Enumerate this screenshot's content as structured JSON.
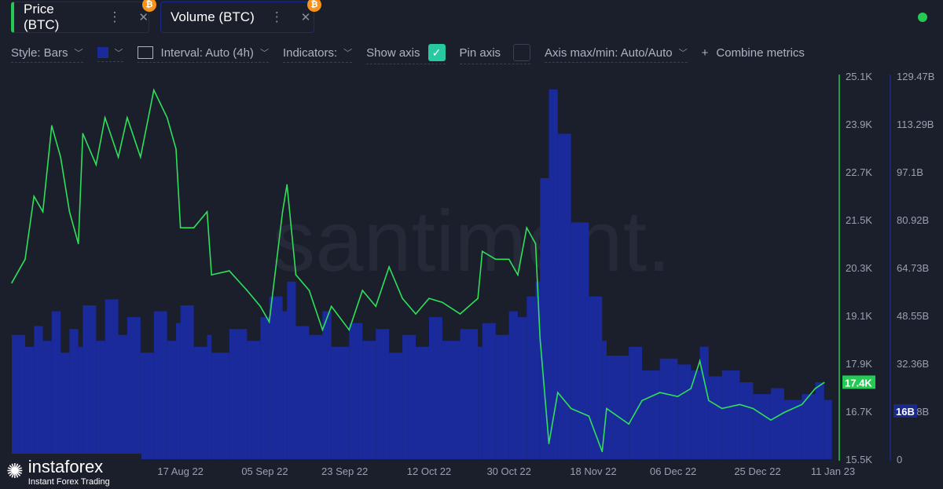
{
  "tabs": [
    {
      "label": "Price (BTC)",
      "color": "#26c953"
    },
    {
      "label": "Volume (BTC)",
      "color": "#1a2a8a"
    }
  ],
  "toolbar": {
    "style": "Style: Bars",
    "interval": "Interval: Auto (4h)",
    "indicators": "Indicators:",
    "show_axis": "Show axis",
    "show_axis_checked": true,
    "pin_axis": "Pin axis",
    "pin_axis_checked": false,
    "axis_maxmin": "Axis max/min: Auto/Auto",
    "combine": "Combine metrics",
    "combine_icon": "+"
  },
  "colors": {
    "price": "#2ee05a",
    "volume": "#1a2a9a",
    "accent": "#26c953"
  },
  "watermark": "santiment.",
  "logo": {
    "name": "instaforex",
    "tagline": "Instant Forex Trading"
  },
  "chart_data": {
    "type": "line+bar",
    "x_ticks": [
      "17 Aug 22",
      "05 Sep 22",
      "23 Sep 22",
      "12 Oct 22",
      "30 Oct 22",
      "18 Nov 22",
      "06 Dec 22",
      "25 Dec 22",
      "11 Jan 23"
    ],
    "x_tick_dates": [
      "2022-08-17",
      "2022-09-05",
      "2022-09-23",
      "2022-10-12",
      "2022-10-30",
      "2022-11-18",
      "2022-12-06",
      "2022-12-25",
      "2023-01-11"
    ],
    "xlim": [
      "2022-07-10",
      "2023-01-11"
    ],
    "price_axis": {
      "ticks": [
        "25.1K",
        "23.9K",
        "22.7K",
        "21.5K",
        "20.3K",
        "19.1K",
        "17.9K",
        "16.7K",
        "15.5K"
      ],
      "ylim": [
        15.5,
        25.1
      ],
      "unit": "K",
      "last": "17.4K"
    },
    "volume_axis": {
      "ticks": [
        "129.47B",
        "113.29B",
        "97.1B",
        "80.92B",
        "64.73B",
        "48.55B",
        "32.36B",
        "16.18B",
        "0"
      ],
      "ylim": [
        0,
        129.47
      ],
      "last": "16B"
    },
    "dates": [
      "2022-07-10",
      "2022-07-13",
      "2022-07-15",
      "2022-07-17",
      "2022-07-19",
      "2022-07-21",
      "2022-07-23",
      "2022-07-25",
      "2022-07-26",
      "2022-07-29",
      "2022-07-31",
      "2022-08-03",
      "2022-08-05",
      "2022-08-08",
      "2022-08-11",
      "2022-08-14",
      "2022-08-16",
      "2022-08-17",
      "2022-08-20",
      "2022-08-23",
      "2022-08-24",
      "2022-08-28",
      "2022-09-01",
      "2022-09-04",
      "2022-09-06",
      "2022-09-09",
      "2022-09-10",
      "2022-09-12",
      "2022-09-15",
      "2022-09-18",
      "2022-09-20",
      "2022-09-24",
      "2022-09-27",
      "2022-09-30",
      "2022-10-03",
      "2022-10-06",
      "2022-10-09",
      "2022-10-12",
      "2022-10-15",
      "2022-10-19",
      "2022-10-23",
      "2022-10-24",
      "2022-10-27",
      "2022-10-30",
      "2022-11-01",
      "2022-11-03",
      "2022-11-05",
      "2022-11-06",
      "2022-11-08",
      "2022-11-10",
      "2022-11-13",
      "2022-11-17",
      "2022-11-20",
      "2022-11-21",
      "2022-11-26",
      "2022-11-29",
      "2022-12-03",
      "2022-12-07",
      "2022-12-10",
      "2022-12-12",
      "2022-12-14",
      "2022-12-17",
      "2022-12-21",
      "2022-12-24",
      "2022-12-28",
      "2022-12-31",
      "2023-01-04",
      "2023-01-07",
      "2023-01-09"
    ],
    "series": [
      {
        "name": "Price (BTC)",
        "type": "line",
        "values": [
          19.92,
          20.51,
          22.09,
          21.7,
          23.86,
          23.07,
          21.7,
          20.9,
          23.66,
          22.88,
          24.06,
          23.07,
          24.06,
          23.07,
          24.75,
          24.06,
          23.27,
          21.3,
          21.3,
          21.7,
          20.12,
          20.22,
          19.73,
          19.33,
          18.94,
          21.7,
          22.38,
          20.12,
          19.73,
          18.74,
          19.33,
          18.74,
          19.73,
          19.33,
          20.32,
          19.53,
          19.14,
          19.53,
          19.43,
          19.14,
          19.53,
          20.71,
          20.51,
          20.51,
          20.12,
          21.3,
          20.9,
          18.54,
          15.89,
          17.17,
          16.77,
          16.58,
          15.69,
          16.77,
          16.38,
          16.97,
          17.17,
          17.07,
          17.27,
          17.96,
          16.97,
          16.77,
          16.87,
          16.77,
          16.48,
          16.67,
          16.87,
          17.27,
          17.42
        ]
      },
      {
        "name": "Volume (BTC)",
        "type": "bar",
        "values": [
          42,
          38,
          45,
          40,
          50,
          36,
          44,
          38,
          52,
          40,
          54,
          42,
          48,
          36,
          50,
          40,
          46,
          52,
          38,
          42,
          36,
          44,
          40,
          48,
          55,
          50,
          60,
          45,
          42,
          50,
          38,
          46,
          40,
          44,
          36,
          42,
          38,
          48,
          40,
          44,
          38,
          46,
          42,
          50,
          48,
          55,
          60,
          95,
          125,
          110,
          80,
          55,
          40,
          35,
          38,
          30,
          34,
          32,
          30,
          38,
          28,
          30,
          26,
          22,
          24,
          20,
          22,
          26,
          20
        ]
      }
    ]
  }
}
